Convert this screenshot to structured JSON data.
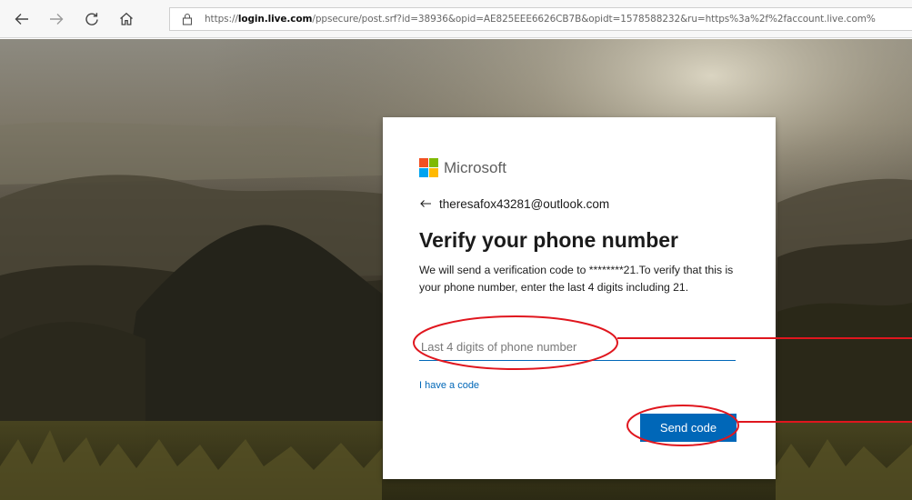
{
  "browser": {
    "url_prefix": "https://",
    "url_host": "login.live.com",
    "url_path": "/ppsecure/post.srf?id=38936&opid=AE825EEE6626CB7B&opidt=1578588232&ru=https%3a%2f%2faccount.live.com%"
  },
  "card": {
    "brand_name": "Microsoft",
    "logo_colors": [
      "#f25022",
      "#7fba00",
      "#00a4ef",
      "#ffb900"
    ],
    "identity": "theresafox43281@outlook.com",
    "title": "Verify your phone number",
    "description": "We will send a verification code to ********21.To verify that this is your phone number, enter the last 4 digits including 21.",
    "input_placeholder": "Last 4 digits of phone number",
    "have_code_link": "I have a code",
    "send_button": "Send code"
  },
  "colors": {
    "accent": "#0067b8",
    "annotation": "#e0161e"
  }
}
